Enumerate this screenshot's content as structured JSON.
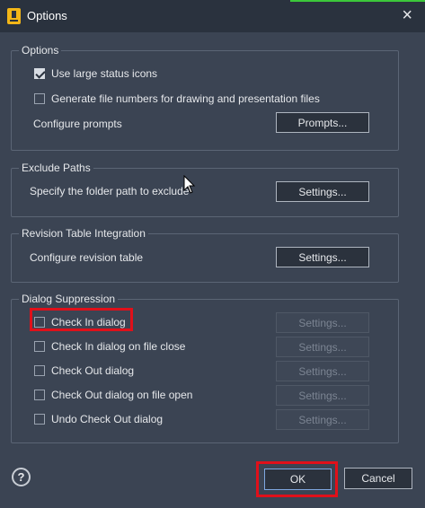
{
  "window": {
    "title": "Options",
    "close_icon": "×"
  },
  "options_group": {
    "legend": "Options",
    "use_large_status_icons": {
      "label": "Use large status icons",
      "checked": true
    },
    "generate_file_numbers": {
      "label": "Generate file numbers for drawing and presentation files",
      "checked": false
    },
    "configure_prompts_label": "Configure prompts",
    "prompts_button": "Prompts..."
  },
  "exclude_paths_group": {
    "legend": "Exclude Paths",
    "label": "Specify the folder path to exclude",
    "settings_button": "Settings..."
  },
  "revision_table_group": {
    "legend": "Revision Table Integration",
    "label": "Configure revision table",
    "settings_button": "Settings..."
  },
  "dialog_suppression_group": {
    "legend": "Dialog Suppression",
    "items": [
      {
        "label": "Check In dialog",
        "checked": false,
        "settings": "Settings..."
      },
      {
        "label": "Check In dialog on file close",
        "checked": false,
        "settings": "Settings..."
      },
      {
        "label": "Check Out dialog",
        "checked": false,
        "settings": "Settings..."
      },
      {
        "label": "Check Out dialog on file open",
        "checked": false,
        "settings": "Settings..."
      },
      {
        "label": "Undo Check Out dialog",
        "checked": false,
        "settings": "Settings..."
      }
    ]
  },
  "footer": {
    "help_icon": "?",
    "ok_button": "OK",
    "cancel_button": "Cancel"
  },
  "colors": {
    "background": "#3b4453",
    "titlebar": "#2a323e",
    "highlight": "#e0101a",
    "accent": "#3cc83a"
  }
}
